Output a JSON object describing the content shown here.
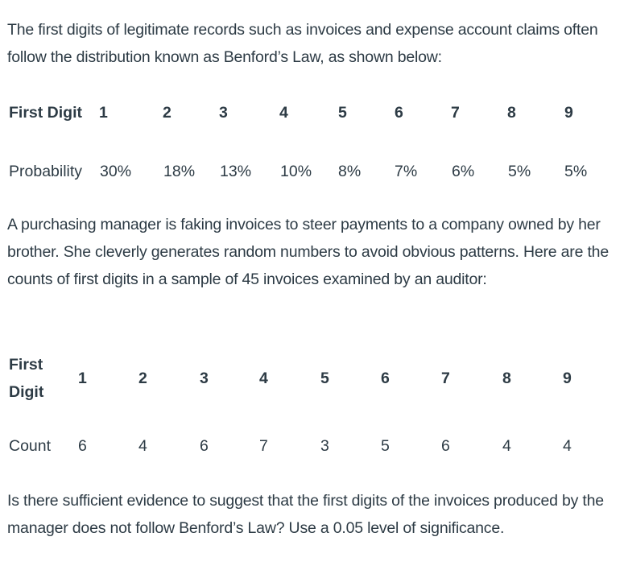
{
  "intro_paragraph": "The first digits of legitimate records such as invoices and expense account claims often follow the distribution known as Benford’s Law, as shown below:",
  "benford_table": {
    "row1_label": "First Digit",
    "row2_label": "Probability",
    "digits": [
      "1",
      "2",
      "3",
      "4",
      "5",
      "6",
      "7",
      "8",
      "9"
    ],
    "probabilities": [
      "30%",
      "18%",
      "13%",
      "10%",
      "8%",
      "7%",
      "6%",
      "5%",
      "5%"
    ]
  },
  "scenario_paragraph": "A purchasing manager is faking invoices to steer payments to a company owned by her brother. She cleverly generates random numbers to avoid obvious patterns. Here are the counts of first digits in a sample of 45 invoices examined by an auditor:",
  "sample_table": {
    "row1_label_line1": "First",
    "row1_label_line2": "Digit",
    "row2_label": "Count",
    "digits": [
      "1",
      "2",
      "3",
      "4",
      "5",
      "6",
      "7",
      "8",
      "9"
    ],
    "counts": [
      "6",
      "4",
      "6",
      "7",
      "3",
      "5",
      "6",
      "4",
      "4"
    ]
  },
  "question_paragraph": "Is there sufficient evidence to suggest that the first digits of the invoices produced by the manager does not follow Benford’s Law? Use a 0.05 level of significance."
}
